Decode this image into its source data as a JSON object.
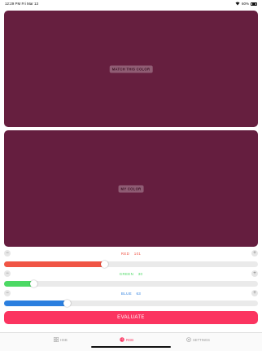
{
  "status": {
    "time": "12:29 PM",
    "date": "Fri Mar 13",
    "battery": "60%"
  },
  "target": {
    "label": "MATCH THIS COLOR",
    "color": "#661f3f"
  },
  "mine": {
    "label": "MY COLOR",
    "color": "#651e3f"
  },
  "sliders": {
    "red": {
      "name": "RED",
      "value": "101",
      "level_fraction": 0.396,
      "color": "#f05545",
      "label_color": "#f05545"
    },
    "green": {
      "name": "GREEN",
      "value": "30",
      "level_fraction": 0.118,
      "color": "#4cd964",
      "label_color": "#4cd964"
    },
    "blue": {
      "name": "BLUE",
      "value": "63",
      "level_fraction": 0.247,
      "color": "#2b7fdf",
      "label_color": "#2b7fdf"
    },
    "minus_symbol": "−",
    "plus_symbol": "+"
  },
  "evaluate": {
    "label": "EVALUATE",
    "color": "#fb3460"
  },
  "tabs": [
    {
      "label": "HSB",
      "icon": "grid-icon",
      "active": false
    },
    {
      "label": "RGB",
      "icon": "palette-icon",
      "active": true
    },
    {
      "label": "SETTINGS",
      "icon": "gear-icon",
      "active": false
    }
  ]
}
